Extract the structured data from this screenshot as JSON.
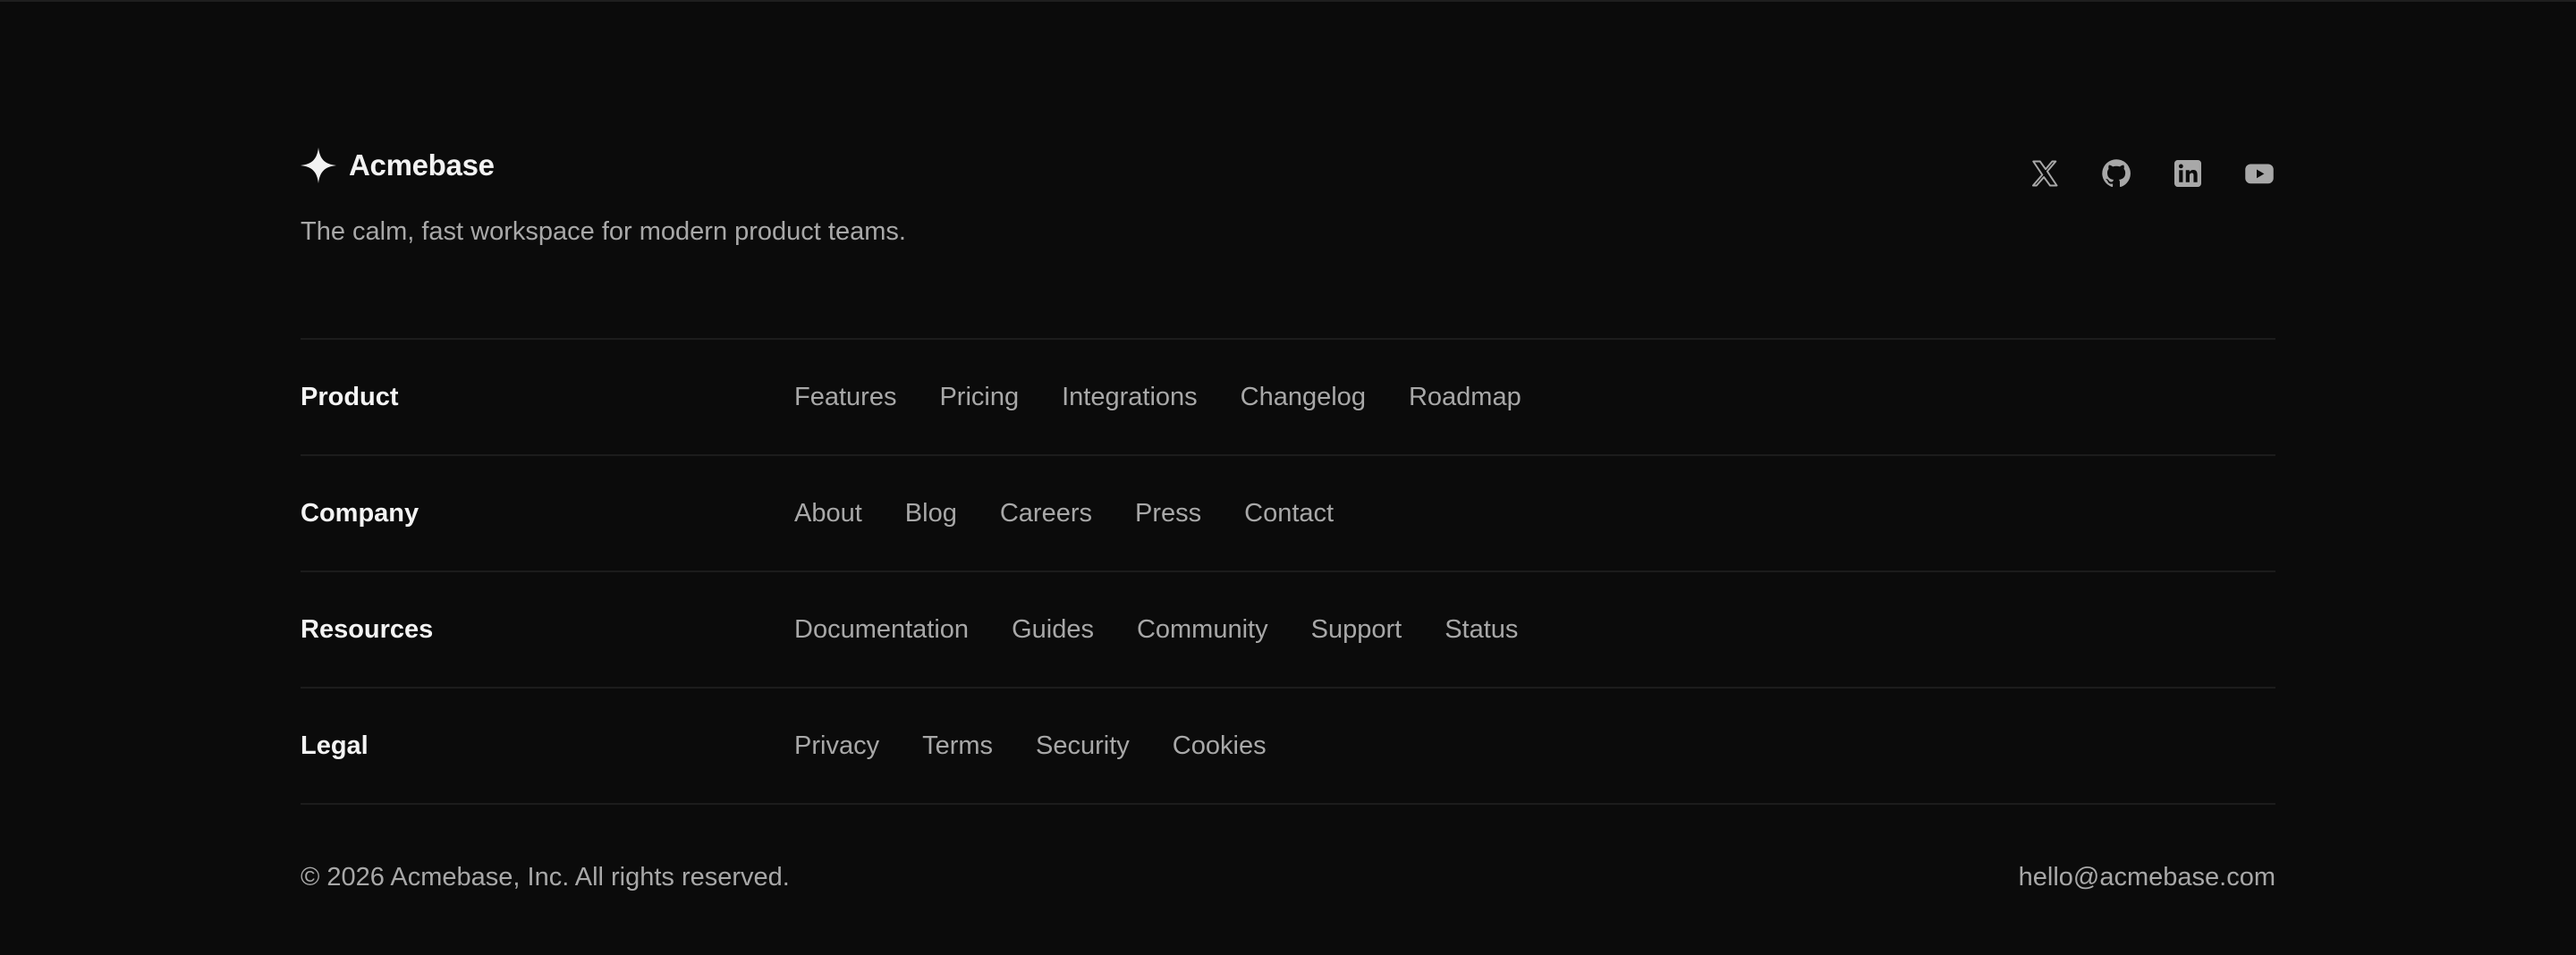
{
  "brand": {
    "name": "Acmebase",
    "tagline": "The calm, fast workspace for modern product teams."
  },
  "social": [
    {
      "icon": "x-icon"
    },
    {
      "icon": "github-icon"
    },
    {
      "icon": "linkedin-icon"
    },
    {
      "icon": "youtube-icon"
    }
  ],
  "sections": [
    {
      "title": "Product",
      "links": [
        "Features",
        "Pricing",
        "Integrations",
        "Changelog",
        "Roadmap"
      ]
    },
    {
      "title": "Company",
      "links": [
        "About",
        "Blog",
        "Careers",
        "Press",
        "Contact"
      ]
    },
    {
      "title": "Resources",
      "links": [
        "Documentation",
        "Guides",
        "Community",
        "Support",
        "Status"
      ]
    },
    {
      "title": "Legal",
      "links": [
        "Privacy",
        "Terms",
        "Security",
        "Cookies"
      ]
    }
  ],
  "bottom": {
    "copyright": "© 2026 Acmebase, Inc. All rights reserved.",
    "email": "hello@acmebase.com"
  },
  "colors": {
    "background": "#0b0b0b",
    "heading": "#f4f4f4",
    "text": "#a8a8a8",
    "divider": "#1c1c1c"
  }
}
